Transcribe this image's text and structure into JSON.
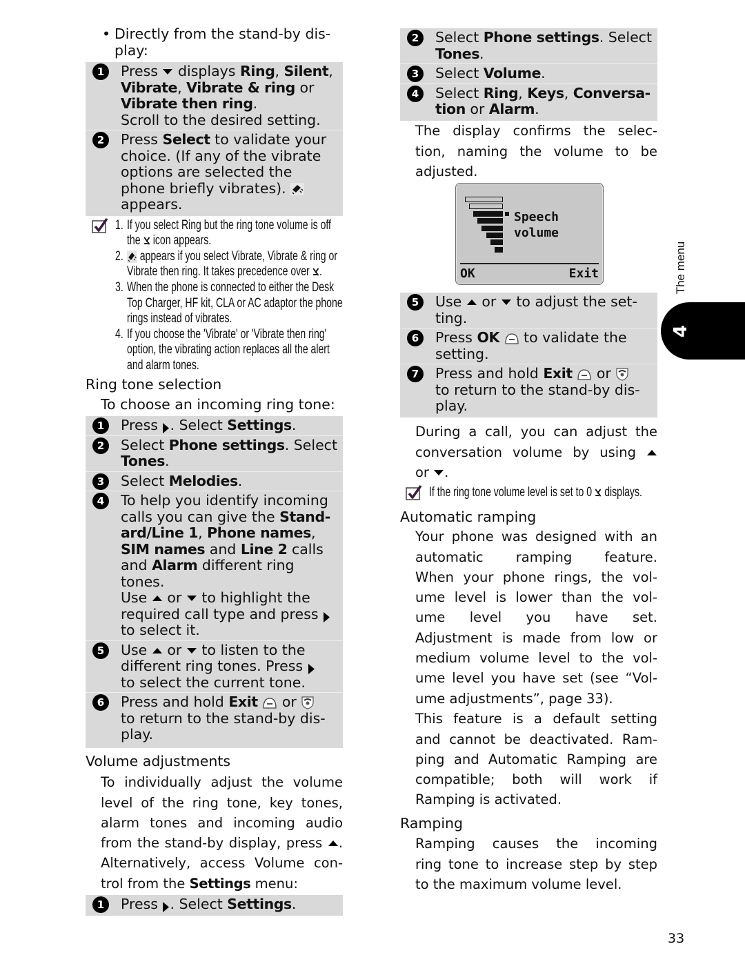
{
  "colors": {
    "step_box_bg": "#d9d9d9",
    "note_check": "#3b1f3b",
    "chapter_tab": "#000000"
  },
  "page": {
    "number": "33",
    "side_tab": {
      "label": "The menu",
      "chapter": "4"
    }
  },
  "left": {
    "intro": {
      "bullet": "•",
      "lines": [
        "Directly from the stand-by dis-",
        "play:"
      ]
    },
    "box_a": {
      "steps": [
        {
          "n": "1",
          "lines": [
            [
              "Press ",
              {
                "icon": "down-arrow"
              },
              " displays ",
              {
                "b": "Ring"
              },
              ", ",
              {
                "b": "Silent"
              },
              ","
            ],
            [
              {
                "b": "Vibrate"
              },
              ", ",
              {
                "b": "Vibrate & ring"
              },
              " or"
            ],
            [
              {
                "b": "Vibrate then ring"
              },
              "."
            ],
            "Scroll to the desired setting."
          ]
        },
        {
          "n": "2",
          "lines": [
            [
              "Press ",
              {
                "b": "Select"
              },
              " to validate your"
            ],
            "choice. (If any of the vibrate",
            "options are selected the",
            [
              "phone briefly vibrates). ",
              {
                "icon": "vibrate"
              }
            ],
            "appears."
          ]
        }
      ]
    },
    "notes": {
      "items": [
        {
          "n": "1.",
          "lines": [
            "If you select Ring but the ring tone volume is off",
            [
              "the ",
              {
                "icon": "silent"
              },
              " icon appears."
            ]
          ]
        },
        {
          "n": "2.",
          "lines": [
            [
              {
                "icon": "vibrate"
              },
              " appears if you select Vibrate, Vibrate & ring or"
            ],
            [
              "Vibrate then ring. It takes precedence over ",
              {
                "icon": "silent"
              },
              "."
            ]
          ]
        },
        {
          "n": "3.",
          "lines": [
            "When the phone is connected to either the Desk",
            "Top Charger, HF kit, CLA or AC adaptor the phone",
            "rings instead of vibrates."
          ]
        },
        {
          "n": "4.",
          "lines": [
            "If you choose the 'Vibrate' or 'Vibrate then ring'",
            "option, the vibrating action replaces all the alert",
            "and alarm tones."
          ]
        }
      ]
    },
    "ring_tone": {
      "heading": "Ring tone selection",
      "intro": "To choose an incoming ring tone:",
      "steps": [
        {
          "n": "1",
          "lines": [
            [
              "Press ",
              {
                "icon": "right-arrow"
              },
              ". Select ",
              {
                "b": "Settings"
              },
              "."
            ]
          ]
        },
        {
          "n": "2",
          "lines": [
            [
              "Select ",
              {
                "b": "Phone settings"
              },
              ". Select"
            ],
            [
              {
                "b": "Tones"
              },
              "."
            ]
          ]
        },
        {
          "n": "3",
          "lines": [
            [
              "Select ",
              {
                "b": "Melodies"
              },
              "."
            ]
          ]
        },
        {
          "n": "4",
          "lines": [
            "To help you identify incoming",
            [
              "calls you can give the ",
              {
                "b": "Stand-"
              }
            ],
            [
              {
                "b": "ard/Line 1"
              },
              ", ",
              {
                "b": "Phone names"
              },
              ","
            ],
            [
              {
                "b": "SIM names"
              },
              " and ",
              {
                "b": "Line 2"
              },
              " calls"
            ],
            [
              "and ",
              {
                "b": "Alarm"
              },
              " different ring"
            ],
            "tones.",
            [
              "Use ",
              {
                "icon": "up-arrow"
              },
              " or ",
              {
                "icon": "down-arrow"
              },
              " to highlight the"
            ],
            [
              "required call type and press ",
              {
                "icon": "right-arrow"
              }
            ],
            "to select it."
          ]
        },
        {
          "n": "5",
          "lines": [
            [
              "Use ",
              {
                "icon": "up-arrow"
              },
              " or ",
              {
                "icon": "down-arrow"
              },
              " to listen to the"
            ],
            [
              "different ring tones. Press ",
              {
                "icon": "right-arrow"
              }
            ],
            "to select the current tone."
          ]
        },
        {
          "n": "6",
          "lines": [
            [
              "Press and hold ",
              {
                "b": "Exit"
              },
              " ",
              {
                "icon": "soft-key"
              },
              " or ",
              {
                "icon": "end-call"
              }
            ],
            "to return to the stand-by dis-",
            "play."
          ]
        }
      ]
    },
    "volume": {
      "heading": "Volume adjustments",
      "paragraph": [
        "To individually adjust the volume",
        "level of the ring tone, key tones,",
        "alarm tones and incoming audio",
        [
          "from the stand-by display, press ",
          {
            "icon": "up-arrow"
          },
          "."
        ],
        "Alternatively, access Volume con-",
        [
          "trol from the ",
          {
            "b": "Settings"
          },
          " menu:"
        ]
      ],
      "steps": [
        {
          "n": "1",
          "lines": [
            [
              "Press ",
              {
                "icon": "right-arrow"
              },
              ". Select ",
              {
                "b": "Settings"
              },
              "."
            ]
          ]
        }
      ]
    }
  },
  "right": {
    "steps_a": [
      {
        "n": "2",
        "lines": [
          [
            "Select ",
            {
              "b": "Phone settings"
            },
            ". Select"
          ],
          [
            {
              "b": "Tones"
            },
            "."
          ]
        ]
      },
      {
        "n": "3",
        "lines": [
          [
            "Select ",
            {
              "b": "Volume"
            },
            "."
          ]
        ]
      },
      {
        "n": "4",
        "lines": [
          [
            "Select ",
            {
              "b": "Ring"
            },
            ", ",
            {
              "b": "Keys"
            },
            ", ",
            {
              "b": "Conversa-"
            }
          ],
          [
            {
              "b": "tion"
            },
            " or ",
            {
              "b": "Alarm"
            },
            "."
          ]
        ]
      }
    ],
    "paragraph_1": [
      "The display confirms the selec-",
      "tion, naming the volume to be",
      "adjusted."
    ],
    "phone_display": {
      "title_lines": [
        "Speech",
        "volume"
      ],
      "volume_level": 6,
      "volume_steps": 8,
      "left_softkey": "OK",
      "right_softkey": "Exit"
    },
    "steps_b": [
      {
        "n": "5",
        "lines": [
          [
            "Use ",
            {
              "icon": "up-arrow"
            },
            " or ",
            {
              "icon": "down-arrow"
            },
            " to adjust the set-"
          ],
          "ting."
        ]
      },
      {
        "n": "6",
        "lines": [
          [
            "Press ",
            {
              "b": "OK"
            },
            " ",
            {
              "icon": "soft-key"
            },
            " to validate the"
          ],
          "setting."
        ]
      },
      {
        "n": "7",
        "lines": [
          [
            "Press and hold ",
            {
              "b": "Exit"
            },
            " ",
            {
              "icon": "soft-key"
            },
            " or ",
            {
              "icon": "end-call"
            }
          ],
          "to return to the stand-by dis-",
          "play."
        ]
      }
    ],
    "paragraph_2": [
      "During a call, you can adjust the",
      [
        "conversation volume by using ",
        {
          "icon": "up-arrow"
        }
      ],
      [
        "or ",
        {
          "icon": "down-arrow"
        },
        "."
      ]
    ],
    "note": {
      "lines": [
        [
          "If the ring tone volume level is set to 0 ",
          {
            "icon": "silent"
          },
          " displays."
        ]
      ]
    },
    "automatic_ramping": {
      "heading": "Automatic ramping",
      "paragraph_1": [
        "Your phone was designed with an",
        "automatic ramping feature.",
        "When your phone rings, the vol-",
        "ume level is lower than the vol-",
        "ume level you have set.",
        "Adjustment is made from low or",
        "medium volume level to the vol-",
        "ume level you have set (see “Vol-",
        "ume adjustments”, page 33)."
      ],
      "paragraph_2": [
        "This feature is a default setting",
        "and cannot be deactivated. Ram-",
        "ping and Automatic Ramping are",
        "compatible; both will work if",
        "Ramping is activated."
      ]
    },
    "ramping": {
      "heading": "Ramping",
      "paragraph": [
        "Ramping causes the incoming",
        "ring tone to increase step by step",
        "to the maximum volume level."
      ]
    }
  }
}
